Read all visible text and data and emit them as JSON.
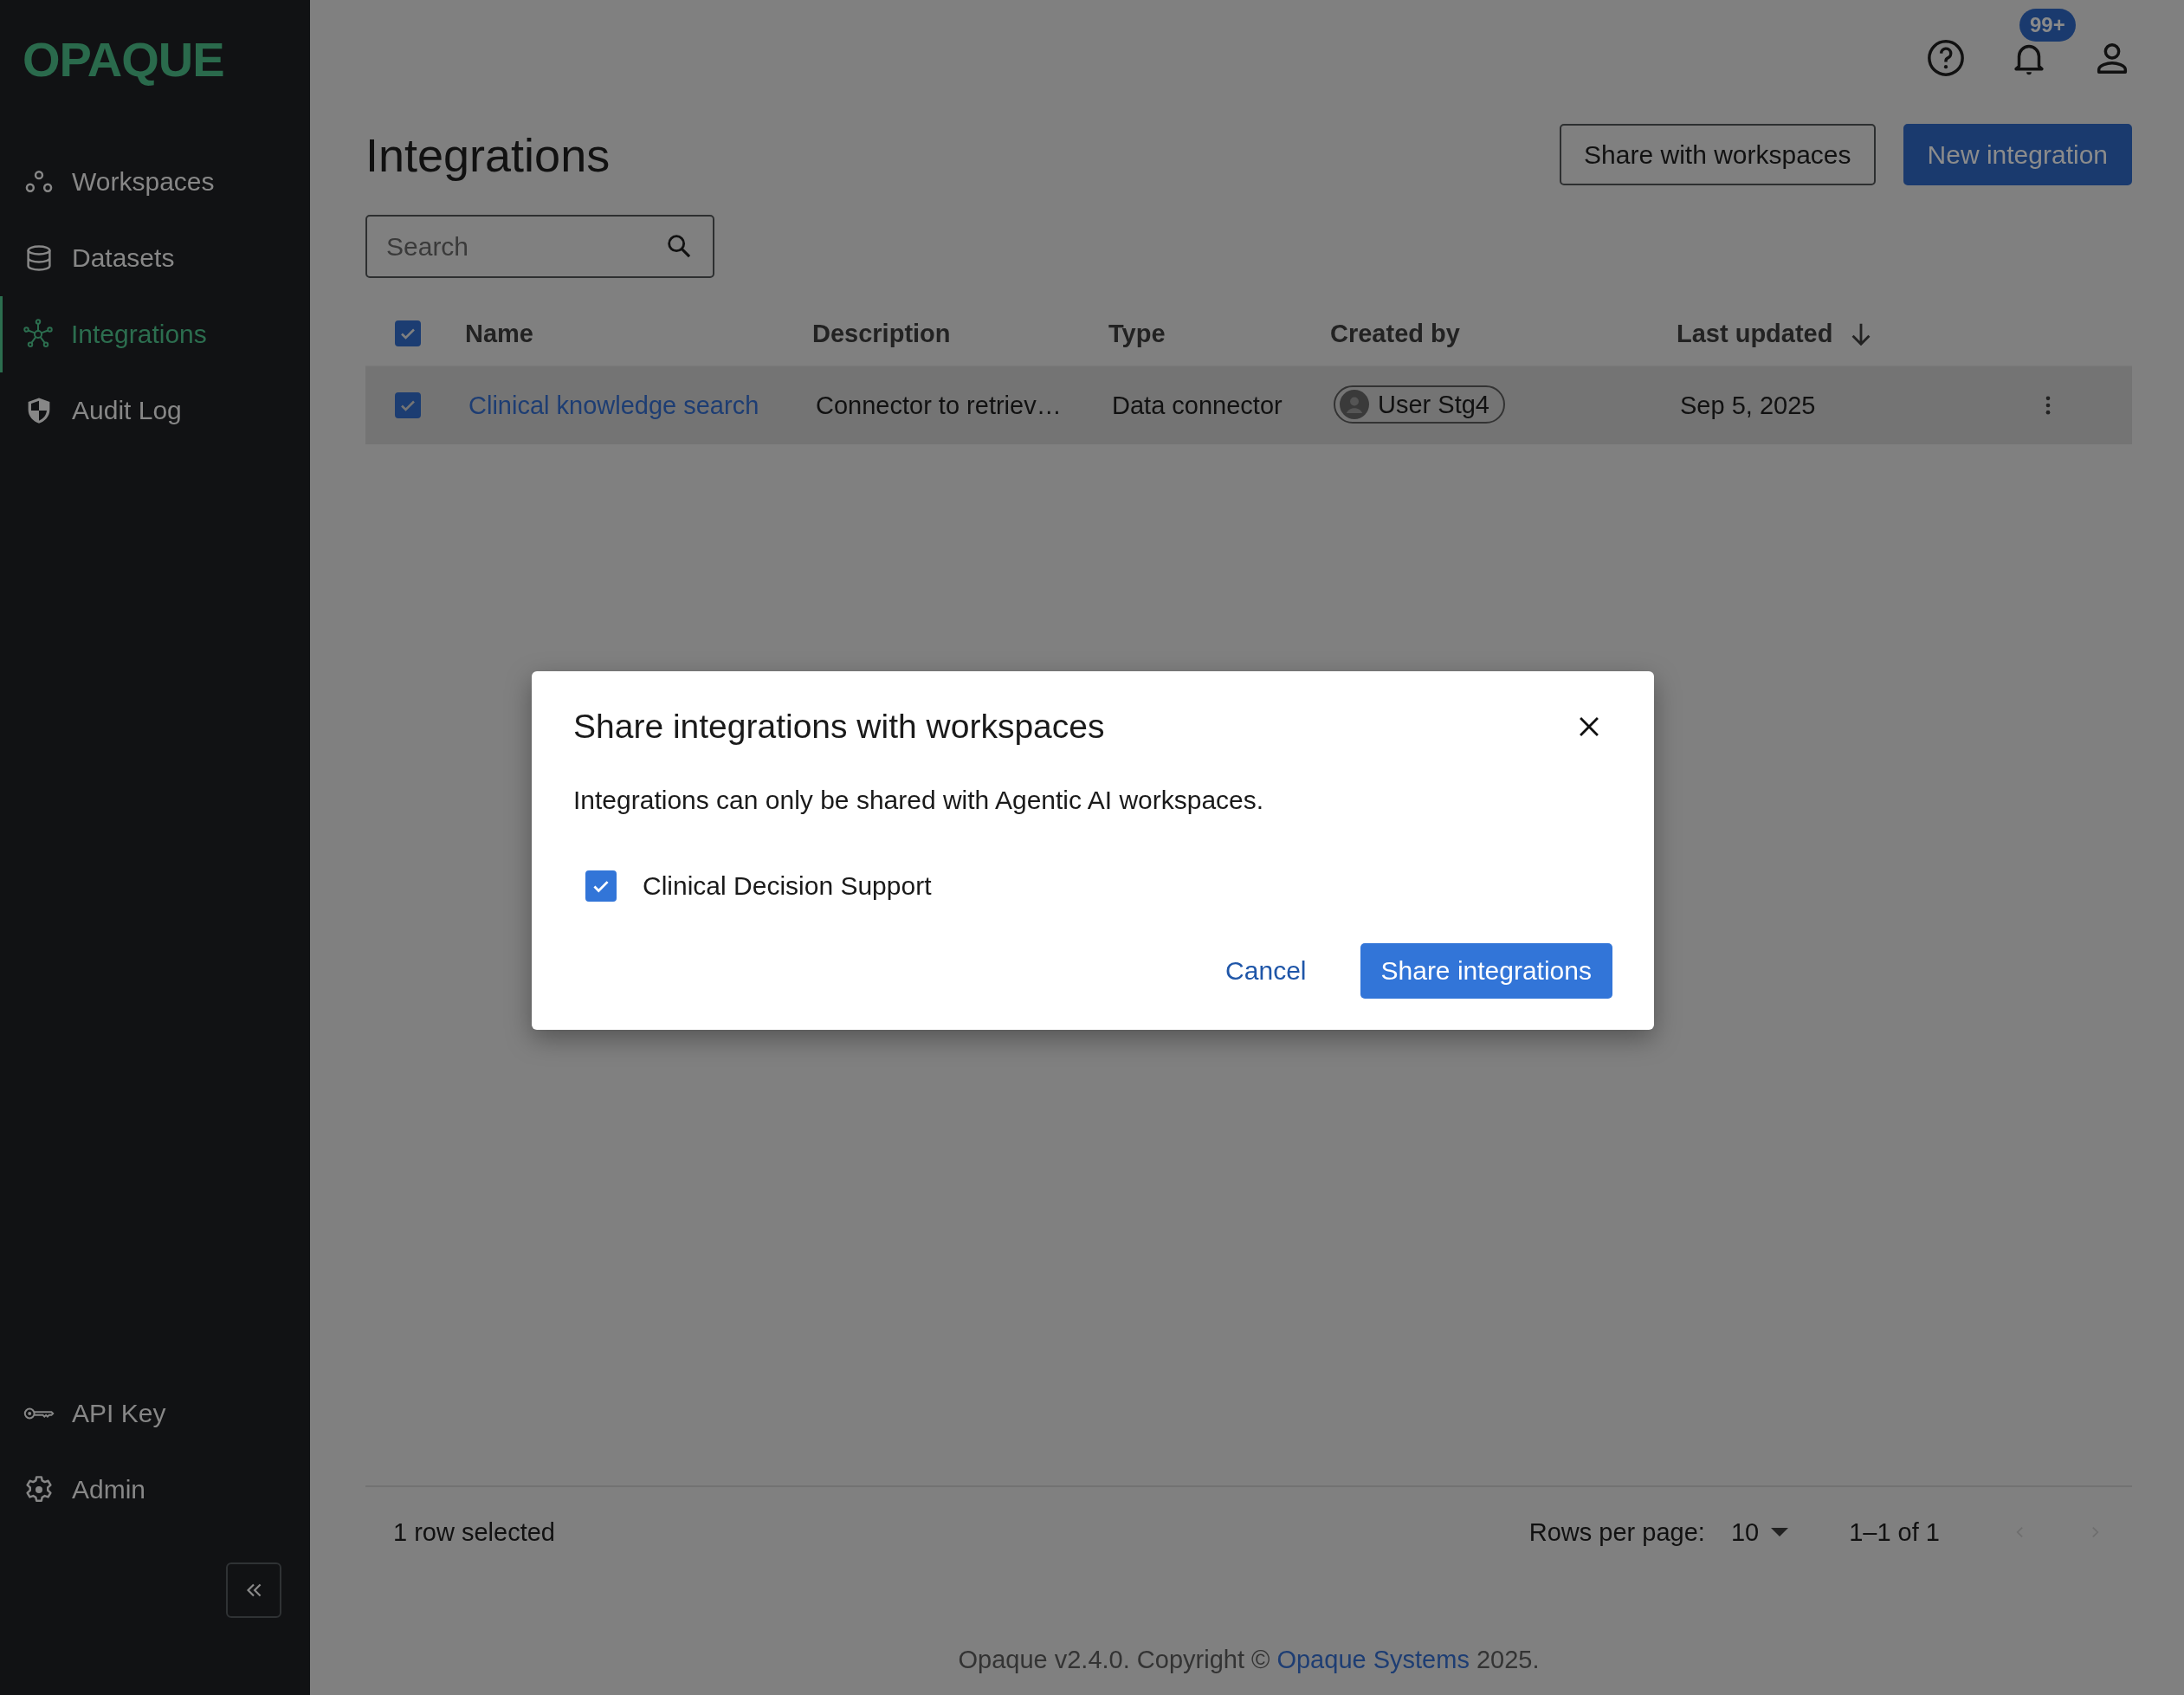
{
  "logo": "OPAQUE",
  "nav": [
    {
      "label": "Workspaces",
      "selected": false
    },
    {
      "label": "Datasets",
      "selected": false
    },
    {
      "label": "Integrations",
      "selected": true
    },
    {
      "label": "Audit Log",
      "selected": false
    }
  ],
  "nav_bottom": [
    {
      "label": "API Key",
      "selected": false
    },
    {
      "label": "Admin",
      "selected": false
    }
  ],
  "notification_count": "99+",
  "page_title": "Integrations",
  "actions": [
    {
      "label": "Share with workspaces",
      "kind": "outlined"
    },
    {
      "label": "New integration",
      "kind": "primary"
    }
  ],
  "search": {
    "placeholder": "Search"
  },
  "table": {
    "all_selected": true,
    "columns": [
      {
        "label": "Name"
      },
      {
        "label": "Description"
      },
      {
        "label": "Type"
      },
      {
        "label": "Created by"
      },
      {
        "label": "Last updated",
        "sorted_descending": true
      }
    ],
    "rows": [
      {
        "selected": true,
        "name": "Clinical knowledge search",
        "description": "Connector to retriev…",
        "type": "Data connector",
        "created_by": "User Stg4",
        "last_updated": "Sep 5, 2025"
      }
    ]
  },
  "footer": {
    "selection": "1 row selected",
    "rows_per_page_label": "Rows per page:",
    "rows_per_page": "10",
    "range": "1–1 of 1"
  },
  "copyright": {
    "before": "Opaque v2.4.0. Copyright ©",
    "link": "Opaque Systems",
    "after": "2025."
  },
  "dialog": {
    "title": "Share integrations with workspaces",
    "message": "Integrations can only be shared with Agentic AI workspaces.",
    "workspaces": [
      {
        "label": "Clinical Decision Support",
        "checked": true
      }
    ],
    "buttons": [
      {
        "label": "Cancel",
        "kind": "text"
      },
      {
        "label": "Share integrations",
        "kind": "primary"
      }
    ]
  }
}
